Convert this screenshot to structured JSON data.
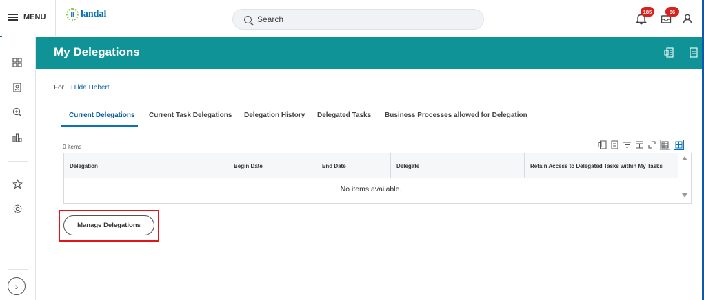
{
  "topbar": {
    "menu_label": "MENU",
    "logo_text": "landal",
    "search_placeholder": "Search",
    "notifications_count": "185",
    "inbox_count": "86"
  },
  "rail": {
    "icons": [
      "dashboard-icon",
      "directory-icon",
      "search-icon",
      "analytics-icon",
      "favorites-icon",
      "settings-icon"
    ]
  },
  "header": {
    "title": "My Delegations",
    "icons": [
      "export-excel-icon",
      "export-pdf-icon"
    ]
  },
  "for": {
    "label": "For",
    "person": "Hilda Hebert"
  },
  "tabs": [
    {
      "label": "Current Delegations",
      "active": true
    },
    {
      "label": "Current Task Delegations",
      "active": false
    },
    {
      "label": "Delegation History",
      "active": false
    },
    {
      "label": "Delegated Tasks",
      "active": false
    },
    {
      "label": "Business Processes allowed for Delegation",
      "active": false
    }
  ],
  "grid": {
    "items_count": "0 items",
    "columns": [
      "Delegation",
      "Begin Date",
      "End Date",
      "Delegate",
      "Retain Access to Delegated Tasks within My Tasks"
    ],
    "empty_message": "No items available."
  },
  "actions": {
    "manage_label": "Manage Delegations"
  },
  "colors": {
    "header_band": "#0f9396",
    "link": "#0b5ea8",
    "highlight": "#e0151b",
    "badge": "#d8211c"
  }
}
